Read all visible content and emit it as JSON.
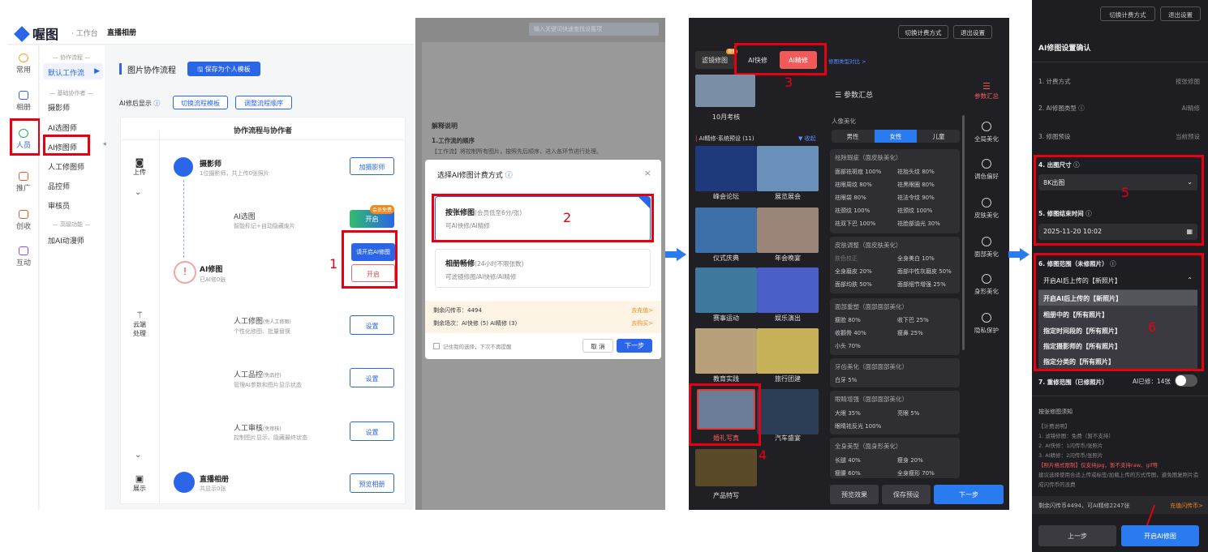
{
  "panel1": {
    "logo": "喔图",
    "workspace": "· 工作台",
    "page_title": "直播相册",
    "rail": [
      "常用",
      "相册",
      "人员",
      "推广",
      "创收",
      "互动"
    ],
    "nav_sec1": "— 协作流程 —",
    "nav_default": "默认工作流",
    "nav_sec2": "— 基础协作者 —",
    "nav_items": [
      "摄影师",
      "AI选图师",
      "AI修图师",
      "人工修图师",
      "品控师",
      "审核员"
    ],
    "nav_sec3": "— 高级功能 —",
    "nav_extra": "加AI动漫师",
    "star": "*",
    "main_title": "图片协作流程",
    "save_template": "保存为个人模板",
    "ai_display": "AI修后显示",
    "switch_flow": "切换流程模板",
    "adjust_order": "调整流程顺序",
    "table_header": "协作流程与协作者",
    "stage_upload": "上传",
    "stage_cloud1": "云端",
    "stage_cloud2": "处理",
    "stage_show": "展示",
    "photographer": "摄影师",
    "photographer_sub": "1位摄影师，共上传0张照片",
    "add_photographer": "加摄影师",
    "ai_select": "AI选图",
    "ai_select_sub": "智能标记+自动隐藏废片",
    "vip_free": "会员免费",
    "open": "开启",
    "please_open": "请开启AI修图",
    "ai_retouch": "AI修图",
    "ai_retouch_sub": "已AI修0张",
    "manual_retouch": "人工修图",
    "manual_tag": "(免人工修图)",
    "manual_sub": "个性化修图、批量替换",
    "qc": "人工品控",
    "qc_tag": "(免品控)",
    "qc_sub": "管理AI参数和图片显示状态",
    "review": "人工审核",
    "review_tag": "(免审核)",
    "review_sub": "控制图片显示、隐藏最终状态",
    "setup": "设置",
    "live_album": "直播相册",
    "live_sub": "共显示0张",
    "preview_album": "预览相册",
    "num1": "1"
  },
  "panel2": {
    "search": "输入关键词快速查找设置项",
    "explain_title": "解释说明",
    "explain_1": "1.工作流的顺序",
    "explain_2": "【工作流】将控制所有图片，按照先后顺序，进入各环节进行处理。",
    "dialog_title": "选择AI修图计费方式",
    "opt1_title": "按张修图",
    "opt1_note": "(会员低至6分/张)",
    "opt1_sub": "可AI快修/AI精修",
    "opt2_title": "相册畅修",
    "opt2_note": "(24小时不限张数)",
    "opt2_sub": "可滤镜修图/AI快修/AI精修",
    "coins": "剩余闪传币：4494",
    "coins_link": "去充值>",
    "scenes": "剩余场次：AI快修 (5) AI精修 (3)",
    "scenes_link": "去购买>",
    "remember": "记住我的选择，下次不再提醒",
    "cancel": "取 消",
    "next": "下一步",
    "num2": "2"
  },
  "panel3": {
    "switch_billing": "切换计费方式",
    "exit": "退出设置",
    "tab_filter": "滤镜修图",
    "tab_quick": "AI快修",
    "tab_fine": "AI精修",
    "tab_new": "限免",
    "desc_link": "修图类型对比 >",
    "summary": "参数汇总",
    "thumb_top": "10月考核",
    "preset_title": "AI精修-系统预设 (11)",
    "collapse": "收起",
    "thumbs": [
      "峰会论坛",
      "展览展会",
      "仪式庆典",
      "年会晚宴",
      "赛事运动",
      "娱乐演出",
      "教育实践",
      "旅行团建",
      "婚礼写真",
      "汽车盛宴",
      "产品特写"
    ],
    "portrait": "人像美化",
    "gender": [
      "男性",
      "女性",
      "儿童"
    ],
    "sec1": "祛除瑕疵（面皮肤美化）",
    "sec1_items": [
      "面部祛斑痘 100%",
      "祛抬头纹 80%",
      "祛眼周纹 80%",
      "祛黑眼圈 80%",
      "祛眼袋 80%",
      "祛法令纹 90%",
      "祛颈纹 100%",
      "祛颈纹 100%",
      "祛双下巴 100%",
      "祛脸部油光 30%"
    ],
    "sec2": "皮肤调整（面皮肤美化）",
    "sec2_items": [
      "肤色校正",
      "全身美白 10%",
      "全身磨皮 20%",
      "面部中性灰磨皮 50%",
      "面部均肤 50%",
      "面部细节增强 25%"
    ],
    "sec3": "面部重塑（面部面部美化）",
    "sec3_items": [
      "瘦脸 80%",
      "收下巴 25%",
      "收颧骨 40%",
      "瘦鼻 25%",
      "小头 70%"
    ],
    "sec4": "牙齿美化（面部面部美化）",
    "sec4_items": [
      "白牙 5%"
    ],
    "sec5": "眼睛增强（面部面部美化）",
    "sec5_items": [
      "大眼 35%",
      "亮眼 5%",
      "眼睛祛反光 100%"
    ],
    "sec6": "全身美型（面身形美化）",
    "sec6_items": [
      "长腿 40%",
      "瘦身 20%",
      "瘦腰 60%",
      "全身瘦形 70%"
    ],
    "side": [
      "参数汇总",
      "全局美化",
      "调色偏好",
      "皮肤美化",
      "面部美化",
      "身形美化",
      "隐私保护"
    ],
    "preview": "预览效果",
    "save_preset": "保存预设",
    "next": "下一步",
    "num3": "3",
    "num4": "4"
  },
  "panel4": {
    "switch_billing": "切换计费方式",
    "exit": "退出设置",
    "title": "AI修图设置确认",
    "r1": "1. 计费方式",
    "r1v": "按张修图",
    "r2": "2. AI修图类型",
    "r2v": "AI精修",
    "r3": "3. 修图预设",
    "r3v": "当前预设",
    "r4": "4. 出图尺寸",
    "r4v": "8K出图",
    "r5": "5. 修图结束时间",
    "r5v": "2025-11-20 10:02",
    "r6": "6. 修图范围（未修照片）",
    "r6v": "开启AI后上传的【新照片】",
    "options": [
      "开启AI后上传的【新照片】",
      "相册中的【所有照片】",
      "指定时间段的【所有照片】",
      "指定摄影师的【所有照片】",
      "指定分类的【所有照片】"
    ],
    "r7": "7. 重修范围（已修照片）",
    "r7v": "AI已修：14张",
    "notice_title": "按张修图须知",
    "notice": [
      "【计费说明】",
      "1. 滤镜修图：免费（暂不支持）",
      "2. AI快修：1闪传币/张照片",
      "3. AI精修：2闪传币/张照片"
    ],
    "notice_red": "【照片格式限制】仅支持jpg，暂不支持raw、gif等",
    "notice_tail": "建议选择使用合适上传或标签/加载上传的方式传图，避免图复照片造成闪传币的浪费",
    "balance": "剩余闪传币4494，可AI精修2247张",
    "recharge": "充值闪传币>",
    "prev": "上一步",
    "start": "开启AI修图",
    "num5": "5",
    "num6": "6"
  },
  "colors": {
    "accent": "#2b66e8",
    "red": "#e60012",
    "dark": "#202024"
  }
}
